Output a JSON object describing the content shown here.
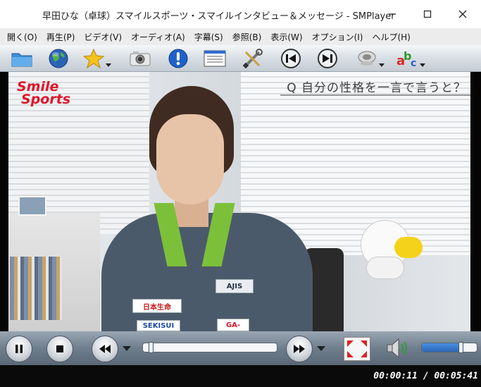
{
  "window": {
    "title": "早田ひな（卓球）スマイルスポーツ・スマイルインタビュー＆メッセージ - SMPlayer"
  },
  "menu": [
    {
      "label": "開く(O)"
    },
    {
      "label": "再生(P)"
    },
    {
      "label": "ビデオ(V)"
    },
    {
      "label": "オーディオ(A)"
    },
    {
      "label": "字幕(S)"
    },
    {
      "label": "参照(B)"
    },
    {
      "label": "表示(W)"
    },
    {
      "label": "オプション(I)"
    },
    {
      "label": "ヘルプ(H)"
    }
  ],
  "toolbar": {
    "icons": [
      "open-folder-icon",
      "open-url-globe-icon",
      "favorites-star-icon",
      "screenshot-camera-icon",
      "info-icon",
      "playlist-icon",
      "preferences-tools-icon",
      "previous-track-icon",
      "next-track-icon",
      "audio-track-icon",
      "subtitles-abc-icon"
    ]
  },
  "video": {
    "brand_line1": "Smile",
    "brand_line2": "Sports",
    "caption": "Q 自分の性格を一言で言うと？",
    "patches": {
      "ajis": "AJIS",
      "nissay": "日本生命",
      "sekisui": "SEKISUI",
      "ga": "GA-"
    }
  },
  "controls": {
    "seek_fraction": 0.033,
    "volume_fraction": 0.72
  },
  "status": {
    "current_time": "00:00:11",
    "separator": " / ",
    "total_time": "00:05:41"
  },
  "colors": {
    "brand_red": "#e0152b",
    "collar_green": "#7cc03a",
    "volume_blue": "#2a67b8"
  }
}
